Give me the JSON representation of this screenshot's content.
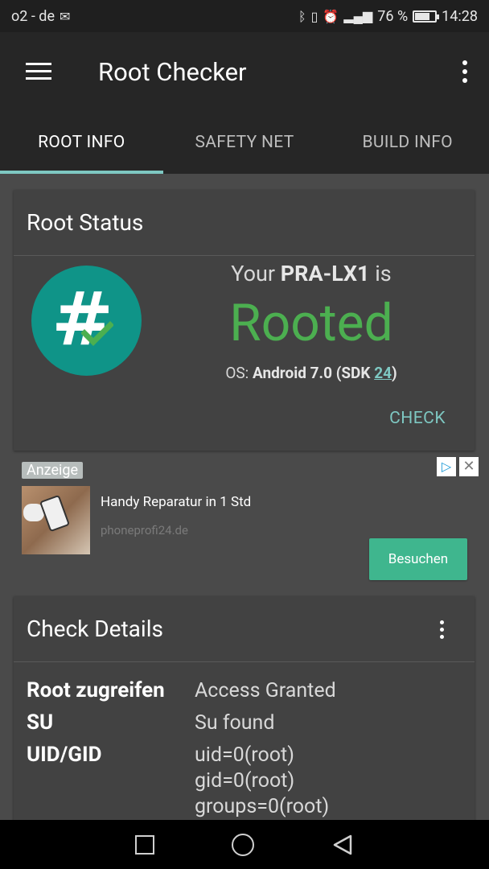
{
  "status_bar": {
    "carrier": "o2 - de",
    "battery_percent": "76 %",
    "battery_level": 0.76,
    "time": "14:28"
  },
  "app_bar": {
    "title": "Root Checker"
  },
  "tabs": [
    {
      "label": "ROOT INFO",
      "active": true
    },
    {
      "label": "SAFETY NET",
      "active": false
    },
    {
      "label": "BUILD INFO",
      "active": false
    }
  ],
  "root_status": {
    "title": "Root Status",
    "your_prefix": "Your",
    "device": "PRA-LX1",
    "your_suffix": "is",
    "status": "Rooted",
    "os_label": "OS:",
    "os_value": "Android 7.0 (SDK",
    "sdk": "24",
    "os_close": ")",
    "check_label": "CHECK",
    "logo_glyph": "#"
  },
  "ad": {
    "label": "Anzeige",
    "headline": "Handy Reparatur in 1 Std",
    "domain": "phoneprofi24.de",
    "cta": "Besuchen",
    "choices_glyph": "▷",
    "close_glyph": "✕"
  },
  "check_details": {
    "title": "Check Details",
    "rows": [
      {
        "key": "Root zugreifen",
        "values": [
          "Access Granted"
        ]
      },
      {
        "key": "SU",
        "values": [
          "Su found"
        ]
      },
      {
        "key": "UID/GID",
        "values": [
          "uid=0(root)",
          "gid=0(root)",
          "groups=0(root)"
        ]
      }
    ]
  },
  "colors": {
    "accent": "#7ec8c2",
    "rooted_green": "#4caf50",
    "logo_teal": "#0f9488",
    "cta_green": "#3fb68e"
  }
}
